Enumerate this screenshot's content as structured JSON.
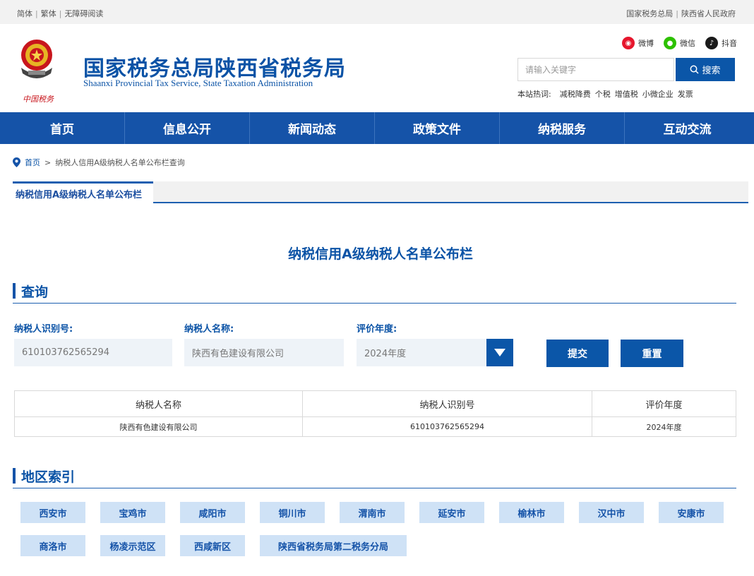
{
  "topbar": {
    "left_links": [
      "简体",
      "繁体",
      "无障碍阅读"
    ],
    "right_links": [
      "国家税务总局",
      "陕西省人民政府"
    ]
  },
  "header": {
    "emblem_caption": "中国税务",
    "title": "国家税务总局陕西省税务局",
    "subtitle": "Shaanxi Provincial Tax Service, State Taxation Administration",
    "social": [
      {
        "icon": "weibo-icon",
        "label": "微博",
        "color": "#e6162d"
      },
      {
        "icon": "wechat-icon",
        "label": "微信",
        "color": "#2dc100"
      },
      {
        "icon": "douyin-icon",
        "label": "抖音",
        "color": "#1a1a1a"
      }
    ],
    "search": {
      "placeholder": "请输入关键字",
      "button_label": "搜索"
    },
    "hotwords": {
      "label": "本站热词:",
      "items": [
        "减税降费",
        "个税",
        "增值税",
        "小微企业",
        "发票"
      ]
    }
  },
  "nav": [
    "首页",
    "信息公开",
    "新闻动态",
    "政策文件",
    "纳税服务",
    "互动交流"
  ],
  "breadcrumb": {
    "home": "首页",
    "separator": ">",
    "current": "纳税人信用A级纳税人名单公布栏查询"
  },
  "panel": {
    "tab_label": "纳税信用A级纳税人名单公布栏",
    "title": "纳税信用A级纳税人名单公布栏",
    "query": {
      "heading": "查询",
      "fields": {
        "taxpayer_id": {
          "label": "纳税人识别号:",
          "value": "610103762565294"
        },
        "taxpayer_name": {
          "label": "纳税人名称:",
          "value": "陕西有色建设有限公司"
        },
        "year": {
          "label": "评价年度:",
          "value": "2024年度"
        }
      },
      "submit_label": "提交",
      "reset_label": "重置"
    },
    "results": {
      "headers": [
        "纳税人名称",
        "纳税人识别号",
        "评价年度"
      ],
      "rows": [
        [
          "陕西有色建设有限公司",
          "610103762565294",
          "2024年度"
        ]
      ]
    },
    "regions": {
      "heading": "地区索引",
      "items": [
        "西安市",
        "宝鸡市",
        "咸阳市",
        "铜川市",
        "渭南市",
        "延安市",
        "榆林市",
        "汉中市",
        "安康市",
        "商洛市",
        "杨凌示范区",
        "西咸新区",
        "陕西省税务局第二税务分局"
      ]
    }
  },
  "colors": {
    "brand_blue": "#1553a8",
    "title_blue": "#0b53a6",
    "field_bg": "#eef3f8",
    "region_bg": "#cfe2f6"
  }
}
